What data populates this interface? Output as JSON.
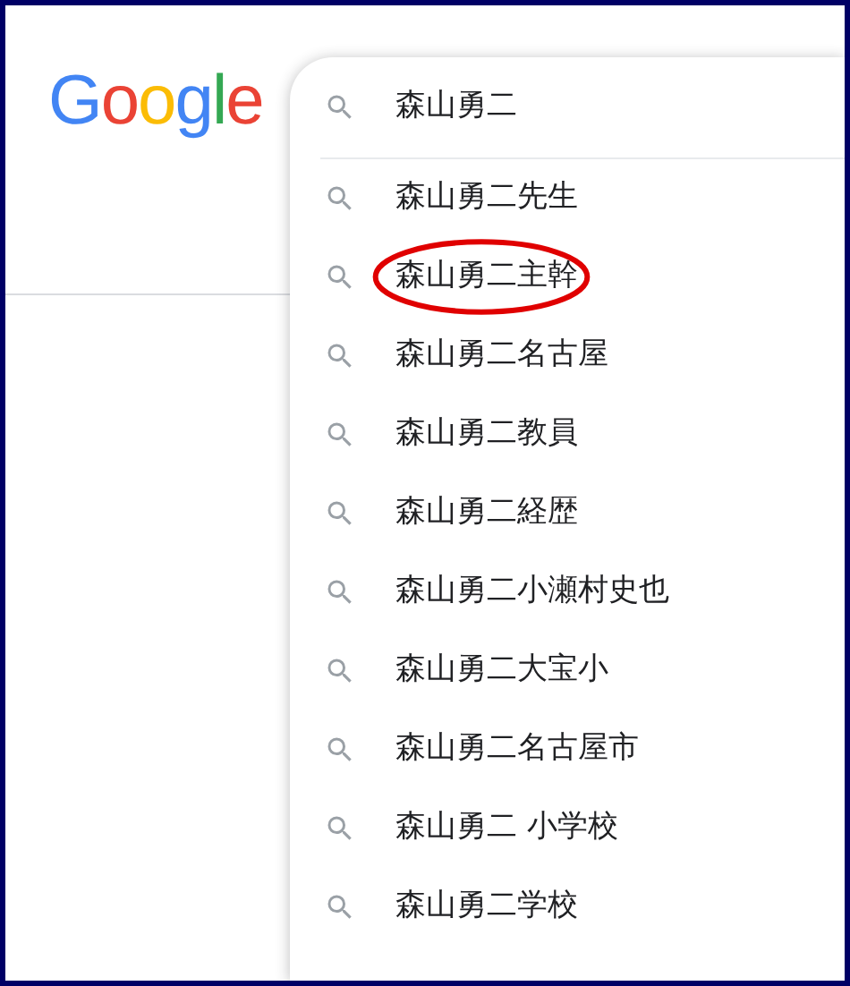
{
  "logo": {
    "text": "Google"
  },
  "search": {
    "value": "森山勇二"
  },
  "suggestions": [
    {
      "text": "森山勇二先生",
      "circled": false
    },
    {
      "text": "森山勇二主幹",
      "circled": true
    },
    {
      "text": "森山勇二名古屋",
      "circled": false
    },
    {
      "text": "森山勇二教員",
      "circled": false
    },
    {
      "text": "森山勇二経歴",
      "circled": false
    },
    {
      "text": "森山勇二小瀬村史也",
      "circled": false
    },
    {
      "text": "森山勇二大宝小",
      "circled": false
    },
    {
      "text": "森山勇二名古屋市",
      "circled": false
    },
    {
      "text": "森山勇二 小学校",
      "circled": false
    },
    {
      "text": "森山勇二学校",
      "circled": false
    }
  ]
}
